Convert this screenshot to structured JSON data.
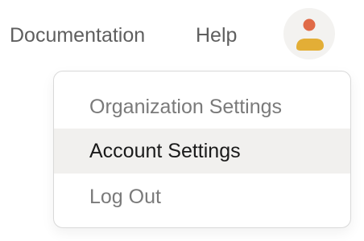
{
  "nav": {
    "documentation_label": "Documentation",
    "help_label": "Help"
  },
  "avatar": {
    "icon": "user-avatar-icon",
    "colors": {
      "head": "#e06a47",
      "body": "#e3ae36",
      "background": "#f3f2f0"
    }
  },
  "dropdown": {
    "items": [
      {
        "label": "Organization Settings",
        "highlighted": false
      },
      {
        "label": "Account Settings",
        "highlighted": true
      },
      {
        "label": "Log Out",
        "highlighted": false
      }
    ],
    "colors": {
      "highlight_bg": "#f1f0ee",
      "border": "#d9d9d9"
    }
  }
}
